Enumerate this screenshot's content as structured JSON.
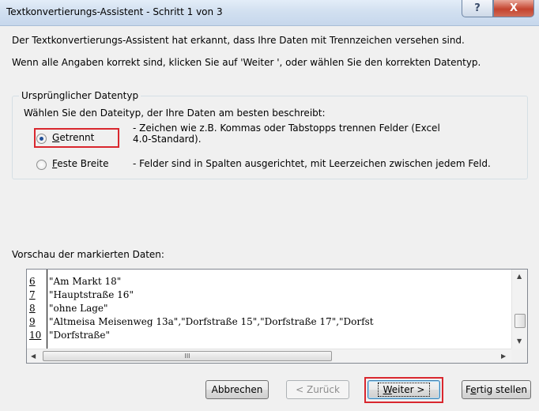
{
  "window": {
    "title": "Textkonvertierungs-Assistent - Schritt 1 von 3",
    "help_label": "?",
    "close_label": "X"
  },
  "intro": {
    "line1": "Der Textkonvertierungs-Assistent hat erkannt, dass Ihre Daten mit Trennzeichen versehen sind.",
    "line2": "Wenn alle Angaben korrekt sind, klicken Sie auf 'Weiter ', oder wählen Sie den korrekten Datentyp."
  },
  "datatype_group": {
    "legend": "Ursprünglicher Datentyp",
    "prompt": "Wählen Sie den Dateityp, der Ihre Daten am besten beschreibt:",
    "options": [
      {
        "mnemonic": "G",
        "label_rest": "etrennt",
        "description": "- Zeichen wie z.B. Kommas oder Tabstopps trennen Felder (Excel 4.0-Standard).",
        "selected": true
      },
      {
        "mnemonic": "F",
        "label_rest": "este Breite",
        "description": "- Felder sind in Spalten ausgerichtet, mit Leerzeichen zwischen jedem Feld.",
        "selected": false
      }
    ]
  },
  "preview": {
    "label": "Vorschau der markierten Daten:",
    "rows": [
      {
        "num": "6",
        "text": "\"Am Markt 18\""
      },
      {
        "num": "7",
        "text": "\"Hauptstraße 16\""
      },
      {
        "num": "8",
        "text": "\"ohne Lage\""
      },
      {
        "num": "9",
        "text": "\"Altmeisa Meisenweg 13a\",\"Dorfstraße 15\",\"Dorfstraße 17\",\"Dorfst"
      },
      {
        "num": "10",
        "text": "\"Dorfstraße\""
      }
    ],
    "hscroll_grip": "III"
  },
  "buttons": {
    "cancel": "Abbrechen",
    "back": "< Zurück",
    "next_mnemonic": "W",
    "next_rest": "eiter >",
    "finish_pre": "F",
    "finish_mnemonic": "e",
    "finish_rest": "rtig stellen"
  },
  "colors": {
    "highlight_red": "#d9272e",
    "title_bar": "#d2e0f0",
    "window_bg": "#f0f0f0"
  }
}
